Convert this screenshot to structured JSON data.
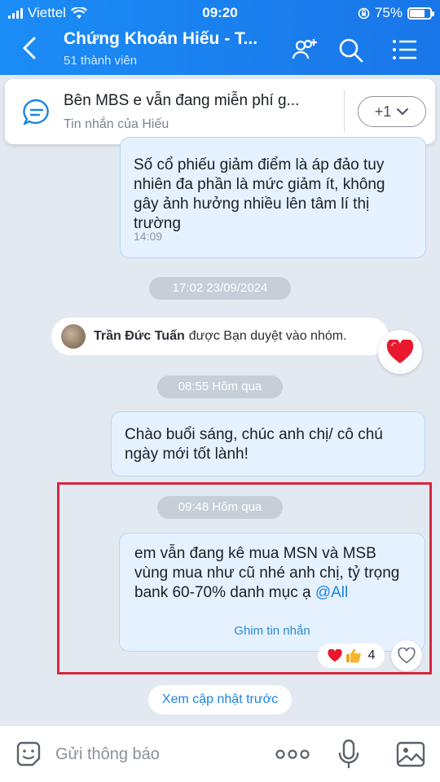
{
  "status_bar": {
    "carrier": "Viettel",
    "time": "09:20",
    "battery": "75%",
    "battery_level": 0.75
  },
  "header": {
    "back_icon": "chevron-left-icon",
    "title": "Chứng Khoán Hiếu - T...",
    "subtitle": "51 thành viên",
    "icons": [
      "add-member-icon",
      "search-icon",
      "menu-list-icon"
    ]
  },
  "pinned": {
    "title": "Bên MBS e vẫn đang miễn phí g...",
    "subtitle": "Tin nhắn của Hiếu",
    "more_label": "+1"
  },
  "messages": {
    "m1": {
      "text": "Số cổ phiếu giảm điểm là áp đảo tuy nhiên đa phần là mức giảm ít, không gây ảnh hưởng nhiều lên tâm lí thị trường",
      "time": "14:09"
    },
    "sep1": "17:02 23/09/2024",
    "system": {
      "name": "Trần Đức Tuấn",
      "action": "được Bạn duyệt vào nhóm."
    },
    "sep2": "08:55 Hôm qua",
    "m2": {
      "text": "Chào buổi sáng, chúc anh chị/ cô chú ngày mới tốt lành!"
    },
    "sep3": "09:48 Hôm qua",
    "m3": {
      "text": "em vẫn đang kê mua MSN và MSB vùng mua như cũ nhé anh chị, tỷ trọng bank 60-70% danh mục ạ",
      "mention": "@All",
      "pin_label": "Ghim tin nhắn",
      "reaction_count": "4",
      "reaction_icons": [
        "heart-icon",
        "thumbs-up-icon"
      ]
    }
  },
  "prev_update": "Xem cập nhật trước",
  "composer": {
    "placeholder": "Gửi thông báo",
    "icons": [
      "sticker-icon",
      "more-dots-icon",
      "microphone-icon",
      "image-icon"
    ]
  },
  "colors": {
    "header": "#1b8cf6",
    "bubble": "#e5f1ff",
    "highlight": "#d7263d",
    "link": "#1b85e6"
  }
}
